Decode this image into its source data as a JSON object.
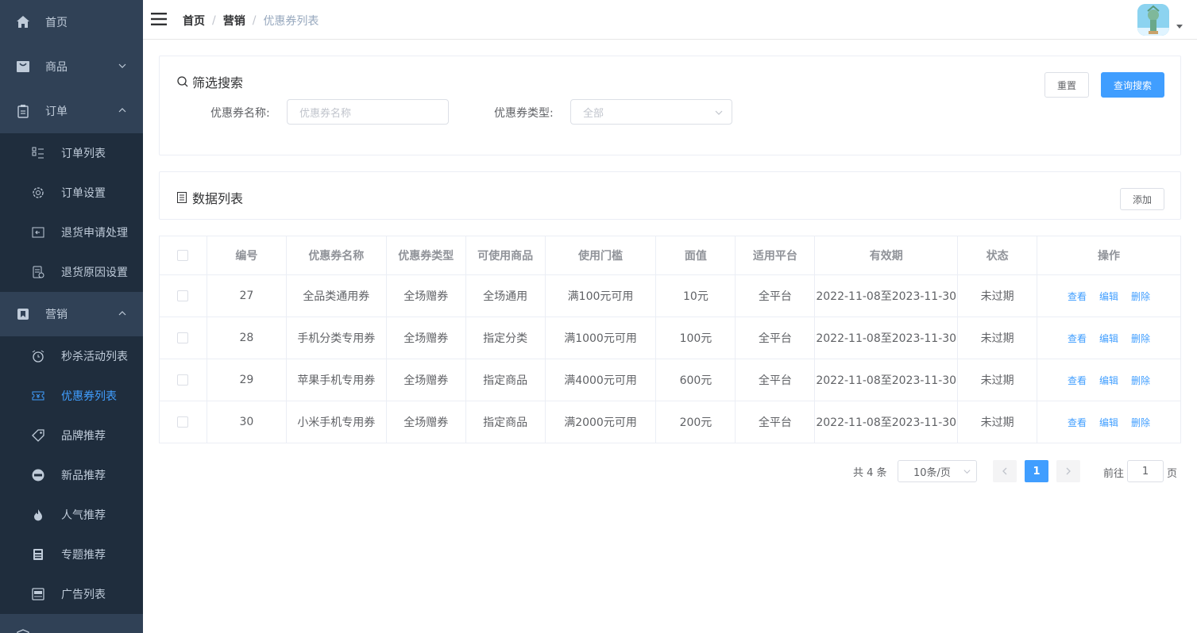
{
  "sidebar": {
    "home": "首页",
    "goods": "商品",
    "order": "订单",
    "order_items": [
      "订单列表",
      "订单设置",
      "退货申请处理",
      "退货原因设置"
    ],
    "marketing": "营销",
    "marketing_items": [
      "秒杀活动列表",
      "优惠券列表",
      "品牌推荐",
      "新品推荐",
      "人气推荐",
      "专题推荐",
      "广告列表"
    ],
    "active_item": "优惠券列表",
    "colors": {
      "bg": "#304156",
      "sub_bg": "#1f2d3d",
      "text": "#bfcbd9",
      "active": "#409eff"
    }
  },
  "header": {
    "breadcrumb": [
      "首页",
      "营销",
      "优惠券列表"
    ],
    "separator": "/"
  },
  "filter": {
    "title": "筛选搜索",
    "reset_label": "重置",
    "search_label": "查询搜索",
    "name_label": "优惠券名称:",
    "name_placeholder": "优惠券名称",
    "type_label": "优惠券类型:",
    "type_value": "全部"
  },
  "list": {
    "title": "数据列表",
    "add_label": "添加"
  },
  "table": {
    "columns": [
      "编号",
      "优惠券名称",
      "优惠券类型",
      "可使用商品",
      "使用门槛",
      "面值",
      "适用平台",
      "有效期",
      "状态",
      "操作"
    ],
    "rows": [
      {
        "id": "27",
        "name": "全品类通用券",
        "type": "全场赠券",
        "goods": "全场通用",
        "threshold": "满100元可用",
        "value": "10元",
        "platform": "全平台",
        "period": "2022-11-08至2023-11-30",
        "status": "未过期"
      },
      {
        "id": "28",
        "name": "手机分类专用券",
        "type": "全场赠券",
        "goods": "指定分类",
        "threshold": "满1000元可用",
        "value": "100元",
        "platform": "全平台",
        "period": "2022-11-08至2023-11-30",
        "status": "未过期"
      },
      {
        "id": "29",
        "name": "苹果手机专用券",
        "type": "全场赠券",
        "goods": "指定商品",
        "threshold": "满4000元可用",
        "value": "600元",
        "platform": "全平台",
        "period": "2022-11-08至2023-11-30",
        "status": "未过期"
      },
      {
        "id": "30",
        "name": "小米手机专用券",
        "type": "全场赠券",
        "goods": "指定商品",
        "threshold": "满2000元可用",
        "value": "200元",
        "platform": "全平台",
        "period": "2022-11-08至2023-11-30",
        "status": "未过期"
      }
    ],
    "actions": [
      "查看",
      "编辑",
      "删除"
    ]
  },
  "pagination": {
    "total": "共 4 条",
    "page_size": "10条/页",
    "current_page": "1",
    "goto_prefix": "前往",
    "goto_value": "1",
    "goto_suffix": "页"
  }
}
